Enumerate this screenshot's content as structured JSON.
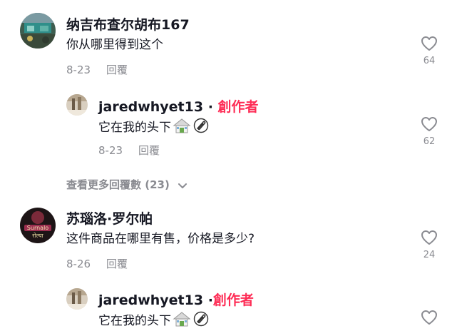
{
  "comments": [
    {
      "username": "纳吉布查尔胡布167",
      "text": "你从哪里得到这个",
      "date": "8-23",
      "reply_label": "回覆",
      "likes": "64",
      "avatar_icon": "photo-avatar"
    },
    {
      "username": "苏瑙洛·罗尔帕",
      "text": "这件商品在哪里有售，价格是多少?",
      "date": "8-26",
      "reply_label": "回覆",
      "likes": "24",
      "avatar_icon": "photo-avatar"
    }
  ],
  "replies": [
    {
      "username": "jaredwhyet13",
      "separator": "·",
      "creator_label": "創作者",
      "text": "它在我的头下",
      "emoji": [
        "house-emoji",
        "paperclip-emoji"
      ],
      "date": "8-23",
      "reply_label": "回覆",
      "likes": "62"
    },
    {
      "username": "jaredwhyet13",
      "separator": "·",
      "creator_label": "創作者",
      "text": "它在我的头下",
      "emoji": [
        "house-emoji",
        "paperclip-emoji"
      ]
    }
  ],
  "view_more": {
    "label": "查看更多回覆數 (23)",
    "icon": "chevron-down-icon"
  },
  "colors": {
    "creator": "#fe2c55",
    "meta": "#8a8b91",
    "text": "#161823"
  }
}
